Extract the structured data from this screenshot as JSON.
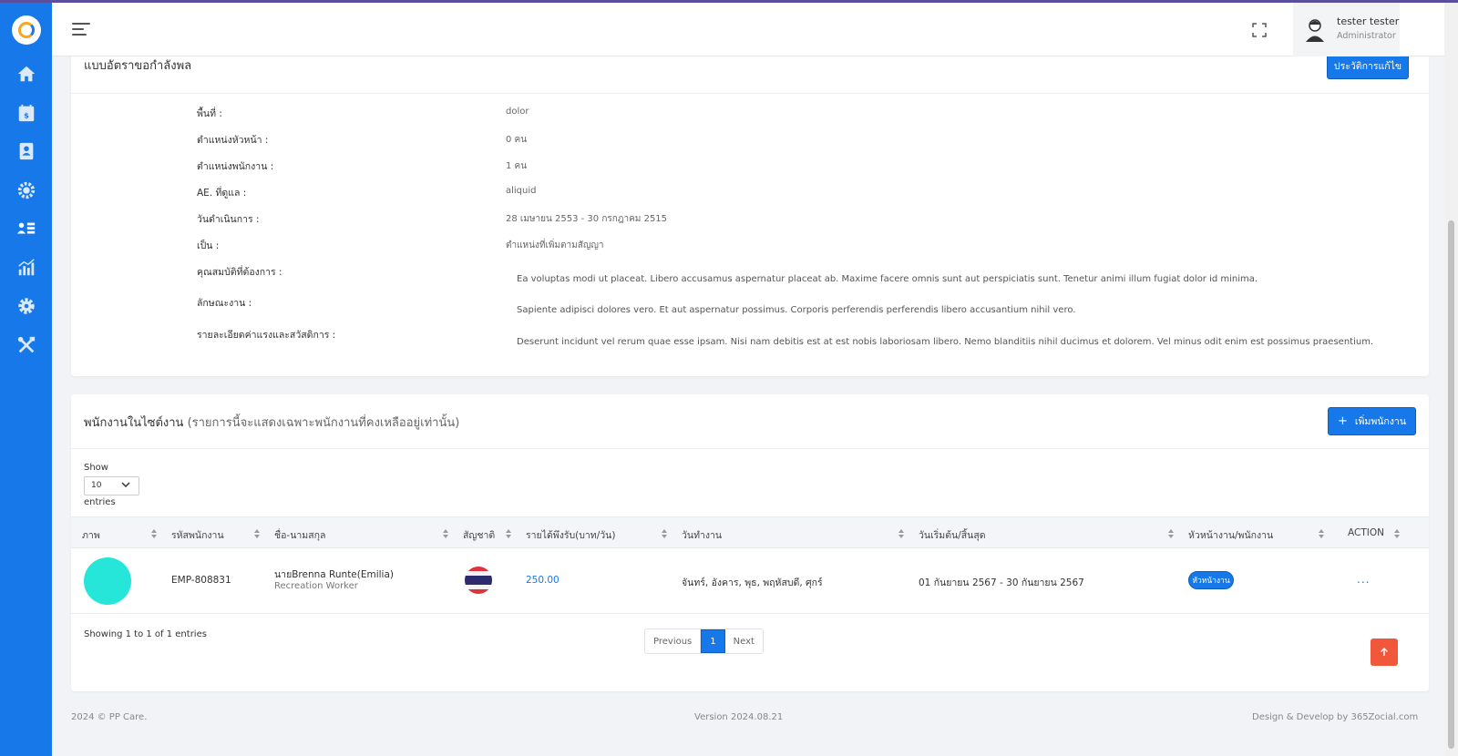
{
  "header": {
    "user_name": "tester tester",
    "user_role": "Administrator"
  },
  "sidebar": {
    "items": [
      {
        "icon": "home-icon"
      },
      {
        "icon": "calendar-money-icon"
      },
      {
        "icon": "contact-book-icon"
      },
      {
        "icon": "team-gear-icon"
      },
      {
        "icon": "user-list-icon"
      },
      {
        "icon": "chart-icon"
      },
      {
        "icon": "settings-icon"
      },
      {
        "icon": "tools-icon"
      }
    ]
  },
  "position_card": {
    "title": "แบบอัตราขอกำลังพล",
    "history_button": "ประวัติการแก้ไข",
    "fields": [
      {
        "label": "พื้นที่ :",
        "value": "dolor"
      },
      {
        "label": "ตำแหน่งหัวหน้า :",
        "value": "0 คน"
      },
      {
        "label": "ตำแหน่งพนักงาน :",
        "value": "1 คน"
      },
      {
        "label": "AE. ที่ดูแล :",
        "value": "aliquid"
      },
      {
        "label": "วันดำเนินการ :",
        "value": "28 เมษายน 2553 - 30 กรกฎาคม 2515"
      },
      {
        "label": "เป็น :",
        "value": "ตำแหน่งที่เพิ่มตามสัญญา"
      },
      {
        "label": "คุณสมบัติที่ต้องการ :",
        "value": "Ea voluptas modi ut placeat. Libero accusamus aspernatur placeat ab. Maxime facere omnis sunt aut perspiciatis sunt. Tenetur animi illum fugiat dolor id minima."
      },
      {
        "label": "ลักษณะงาน :",
        "value": "Sapiente adipisci dolores vero. Et aut aspernatur possimus. Corporis perferendis perferendis libero accusantium nihil vero."
      },
      {
        "label": "รายละเอียดค่าแรงและสวัสดิการ :",
        "value": "Deserunt incidunt vel rerum quae esse ipsam. Nisi nam debitis est at est nobis laboriosam libero. Nemo blanditiis nihil ducimus et dolorem. Vel minus odit enim est possimus praesentium."
      }
    ]
  },
  "employee_card": {
    "title": "พนักงานในไซต์งาน",
    "subtitle": "(รายการนี้จะแสดงเฉพาะพนักงานที่คงเหลืออยู่เท่านั้น)",
    "add_button": "เพิ่มพนักงาน",
    "show_label": "Show",
    "entries_value": "10",
    "entries_label": "entries",
    "columns": [
      "ภาพ",
      "รหัสพนักงาน",
      "ชื่อ-นามสกุล",
      "สัญชาติ",
      "รายได้พึงรับ(บาท/วัน)",
      "วันทำงาน",
      "วันเริ่มต้น/สิ้นสุด",
      "หัวหน้างาน/พนักงาน",
      "ACTION"
    ],
    "rows": [
      {
        "code": "EMP-808831",
        "name": "นายBrenna Runte(Emilia)",
        "job": "Recreation Worker",
        "nationality_icon": "thai-flag-icon",
        "income": "250.00",
        "workdays": "จันทร์, อังคาร, พุธ, พฤหัสบดี, ศุกร์",
        "period": "01 กันยายน 2567 - 30 กันยายน 2567",
        "role_badge": "หัวหน้างาน",
        "action": "..."
      }
    ],
    "showing_text": "Showing 1 to 1 of 1 entries",
    "pagination": {
      "previous": "Previous",
      "current": "1",
      "next": "Next"
    }
  },
  "footer": {
    "copyright": "2024 © PP Care.",
    "version": "Version 2024.08.21",
    "credit": "Design & Develop by 365Zocial.com"
  },
  "colors": {
    "primary": "#1778e9",
    "accent_orange": "#f0573b",
    "avatar_placeholder": "#26e5d9"
  }
}
